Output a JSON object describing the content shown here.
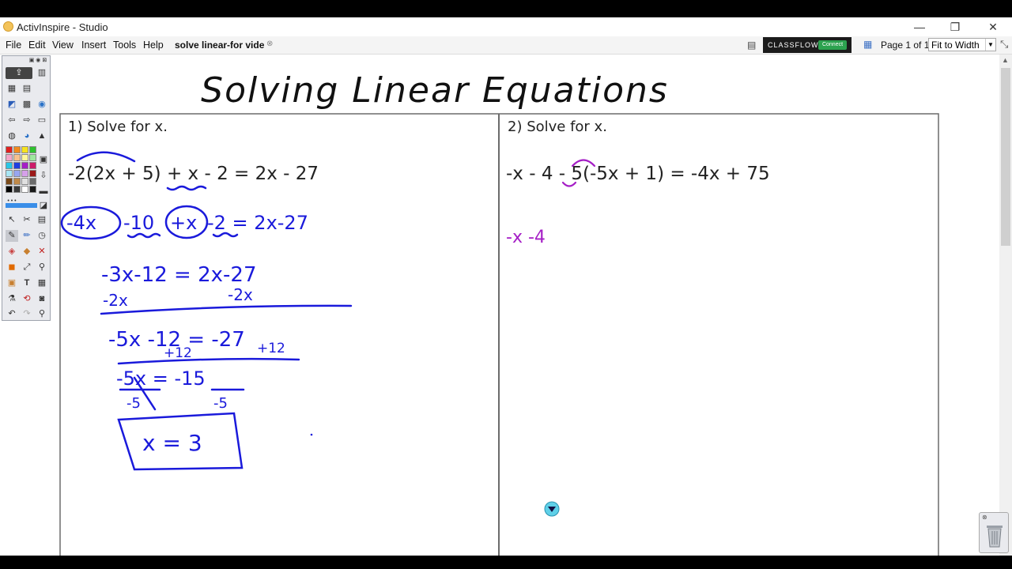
{
  "window": {
    "title": "ActivInspire - Studio",
    "minimize": "—",
    "restore": "❐",
    "close": "✕"
  },
  "menu": [
    "File",
    "Edit",
    "View",
    "Insert",
    "Tools",
    "Help"
  ],
  "tab": {
    "name": "solve linear-for vide"
  },
  "classflow": {
    "brand": "CLASSFLOW",
    "button": "Connect"
  },
  "page": {
    "indicator": "Page 1 of 1",
    "zoom": "Fit to Width"
  },
  "flipchart": {
    "title": "Solving Linear Equations",
    "problem1": {
      "prompt": "1)  Solve for x.",
      "equation": "-2(2x + 5) + x - 2 = 2x - 27",
      "steps": {
        "s1": [
          "-4x",
          "-10",
          "+x",
          "-2 = 2x-27"
        ],
        "s2": "-3x-12 = 2x-27",
        "s2sub_left": "-2x",
        "s2sub_right": "-2x",
        "s3": "-5x -12 = -27",
        "s3add_left": "+12",
        "s3add_right": "+12",
        "s4": "-5x = -15",
        "s4den_left": "-5",
        "s4den_right": "-5",
        "answer": "x = 3"
      }
    },
    "problem2": {
      "prompt": "2)  Solve for x.",
      "equation": "-x - 4 - 5(-5x + 1) = -4x + 75",
      "work": "-x -4"
    }
  },
  "colors": {
    "ink_blue": "#1a1adb",
    "ink_purple": "#a51fc6",
    "chrome": "#e9eaee"
  }
}
